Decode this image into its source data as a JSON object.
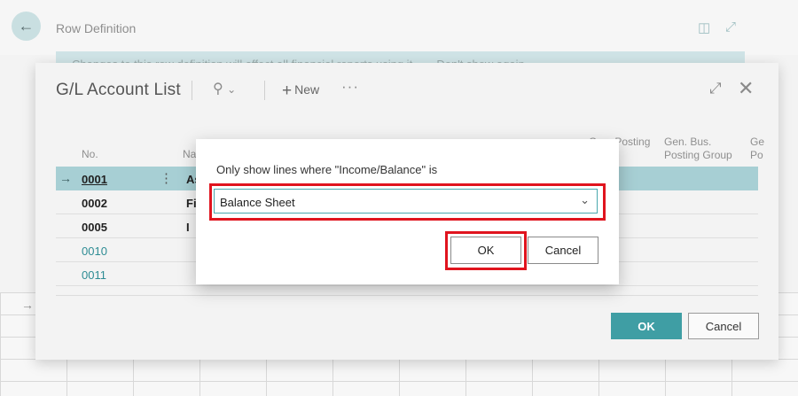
{
  "background": {
    "title": "Row Definition",
    "banner_text": "Changes to this row definition will affect all financial reports using it.",
    "banner_action": "Don't show again"
  },
  "panel": {
    "title": "G/L Account List",
    "new_label": "New",
    "more_label": "···",
    "columns": {
      "no": "No.",
      "name": "Na",
      "gen_posting": "Gen. Posting",
      "gen_bus_line1": "Gen. Bus.",
      "gen_bus_line2": "Posting Group",
      "gen_prod_line1": "Ge",
      "gen_prod_line2": "Po"
    },
    "rows": [
      {
        "no": "0001",
        "name": "As"
      },
      {
        "no": "0002",
        "name": "Fi"
      },
      {
        "no": "0005",
        "name": "I"
      },
      {
        "no": "0010",
        "name": ""
      },
      {
        "no": "0011",
        "name": ""
      }
    ],
    "ok_label": "OK",
    "cancel_label": "Cancel"
  },
  "dialog": {
    "label": "Only show lines where \"Income/Balance\" is",
    "selected_value": "Balance Sheet",
    "ok_label": "OK",
    "cancel_label": "Cancel"
  },
  "colors": {
    "accent": "#3f9ea4",
    "selected_row": "#a7cfd4",
    "highlight": "#e0141e"
  }
}
